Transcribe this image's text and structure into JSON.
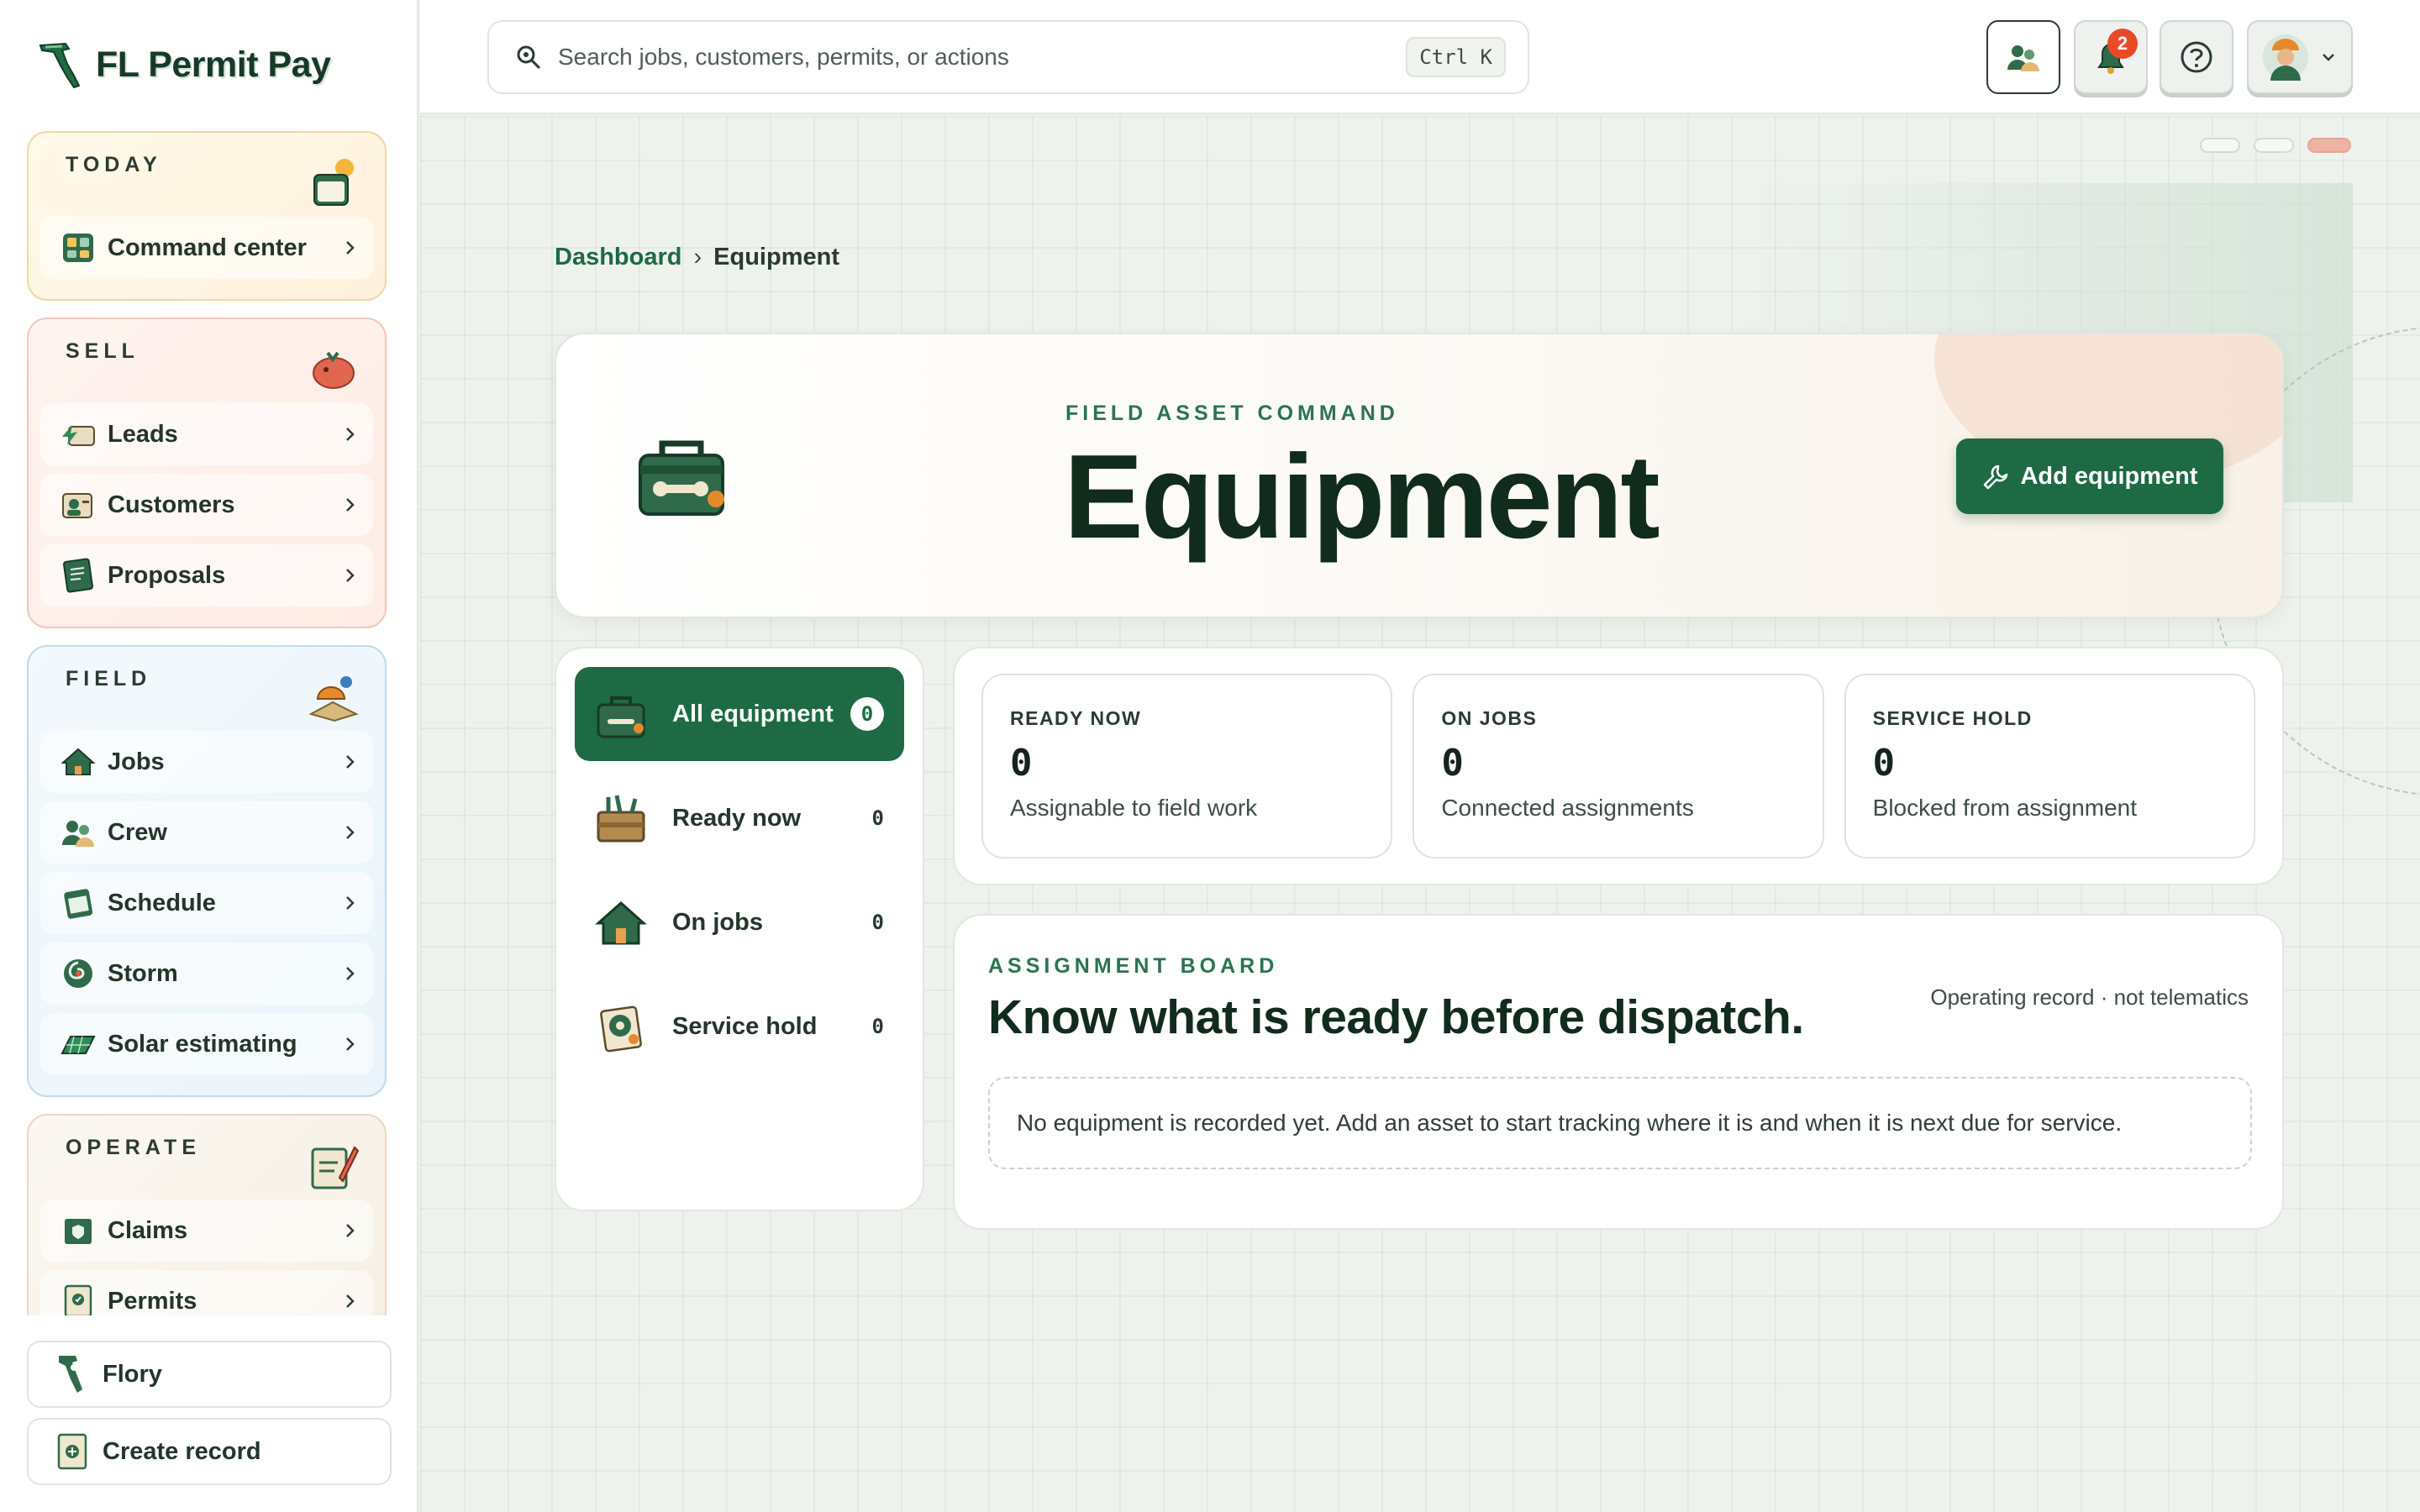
{
  "app": {
    "name": "FL Permit Pay"
  },
  "sidebar": {
    "sections": [
      {
        "title": "TODAY",
        "items": [
          {
            "label": "Command center"
          }
        ]
      },
      {
        "title": "SELL",
        "items": [
          {
            "label": "Leads"
          },
          {
            "label": "Customers"
          },
          {
            "label": "Proposals"
          }
        ]
      },
      {
        "title": "FIELD",
        "items": [
          {
            "label": "Jobs"
          },
          {
            "label": "Crew"
          },
          {
            "label": "Schedule"
          },
          {
            "label": "Storm"
          },
          {
            "label": "Solar estimating"
          }
        ]
      },
      {
        "title": "OPERATE",
        "items": [
          {
            "label": "Claims"
          },
          {
            "label": "Permits"
          }
        ]
      }
    ],
    "footer": {
      "flory_label": "Flory",
      "create_label": "Create record"
    }
  },
  "topbar": {
    "search_placeholder": "Search jobs, customers, permits, or actions",
    "shortcut": "Ctrl K",
    "notification_count": "2"
  },
  "breadcrumb": {
    "parent": "Dashboard",
    "separator": "›",
    "current": "Equipment"
  },
  "hero": {
    "eyebrow": "FIELD ASSET COMMAND",
    "title": "Equipment",
    "add_button": "Add equipment"
  },
  "filters": [
    {
      "label": "All equipment",
      "count": "0",
      "active": true
    },
    {
      "label": "Ready now",
      "count": "0"
    },
    {
      "label": "On jobs",
      "count": "0"
    },
    {
      "label": "Service hold",
      "count": "0"
    }
  ],
  "stats": [
    {
      "label": "READY NOW",
      "value": "0",
      "desc": "Assignable to field work"
    },
    {
      "label": "ON JOBS",
      "value": "0",
      "desc": "Connected assignments"
    },
    {
      "label": "SERVICE HOLD",
      "value": "0",
      "desc": "Blocked from assignment"
    }
  ],
  "board": {
    "eyebrow": "ASSIGNMENT BOARD",
    "title": "Know what is ready before dispatch.",
    "note": "Operating record · not telematics",
    "empty": "No equipment is recorded yet. Add an asset to start tracking where it is and when it is next due for service."
  },
  "colors": {
    "brand_green": "#1d6a44",
    "badge_red": "#e84a27",
    "ink": "#112b1d"
  }
}
